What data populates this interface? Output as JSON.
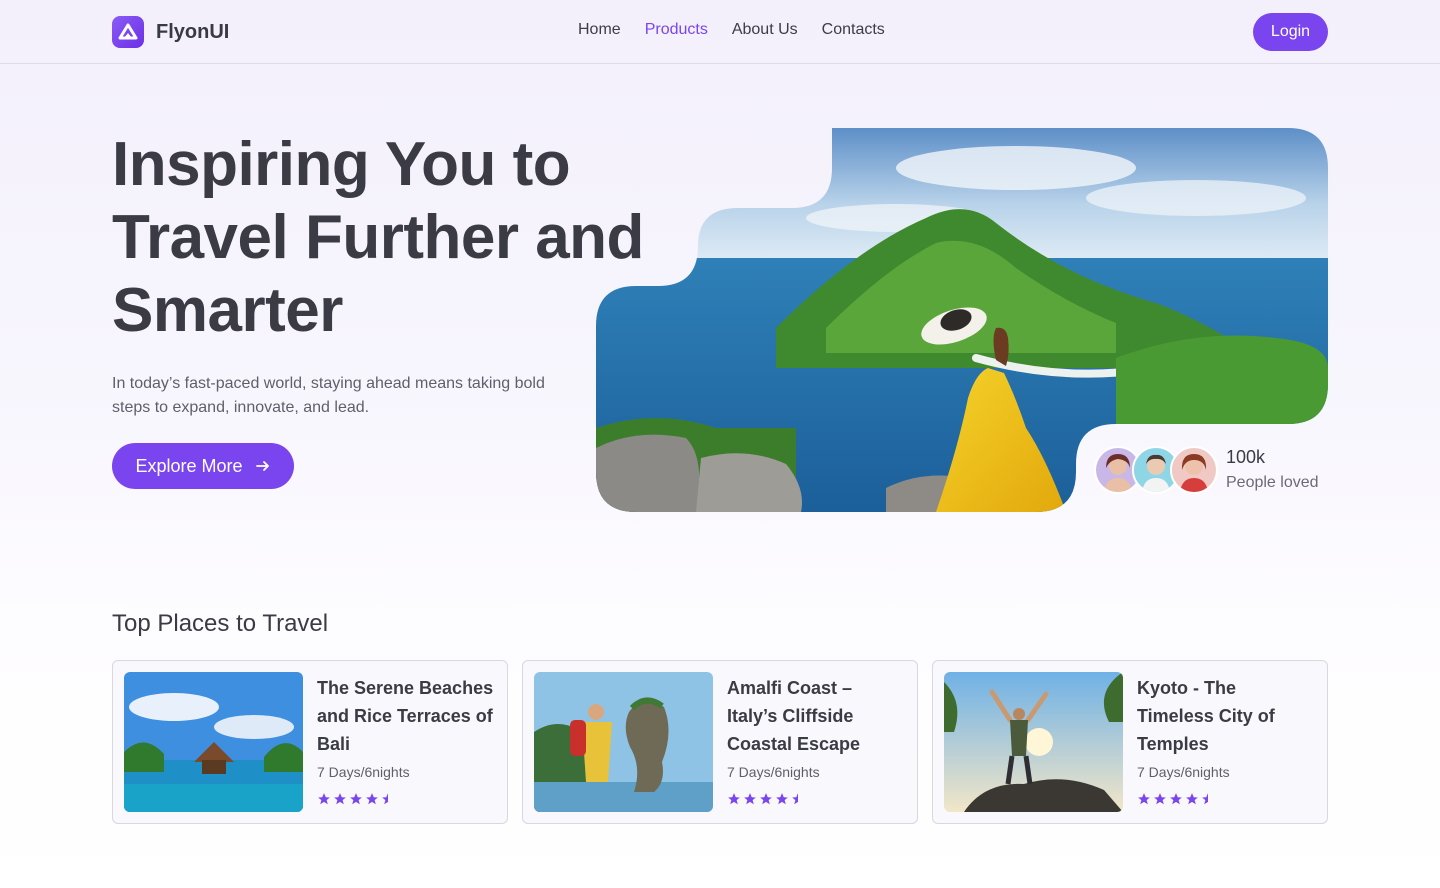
{
  "header": {
    "brand": "FlyonUI",
    "nav": [
      {
        "label": "Home",
        "active": false
      },
      {
        "label": "Products",
        "active": true
      },
      {
        "label": "About Us",
        "active": false
      },
      {
        "label": "Contacts",
        "active": false
      }
    ],
    "login_label": "Login"
  },
  "hero": {
    "title_lines": [
      "Inspiring You to",
      "Travel Further and",
      "Smarter"
    ],
    "description": "In today’s fast-paced world, staying ahead means taking bold steps to expand, innovate, and lead.",
    "cta_label": "Explore More",
    "social_proof": {
      "count": "100k",
      "label": "People loved"
    }
  },
  "places": {
    "title": "Top Places to Travel",
    "items": [
      {
        "title": "The Serene Beaches and Rice Terraces of Bali",
        "duration": "7 Days/6nights",
        "rating": 4.5
      },
      {
        "title": "Amalfi Coast – Italy’s Cliffside Coastal Escape",
        "duration": "7 Days/6nights",
        "rating": 4.5
      },
      {
        "title": "Kyoto - The Timeless City of Temples",
        "duration": "7 Days/6nights",
        "rating": 4.5
      }
    ]
  },
  "colors": {
    "accent": "#7a45ee",
    "text": "#3b3b45",
    "muted": "#5f5f6a"
  }
}
